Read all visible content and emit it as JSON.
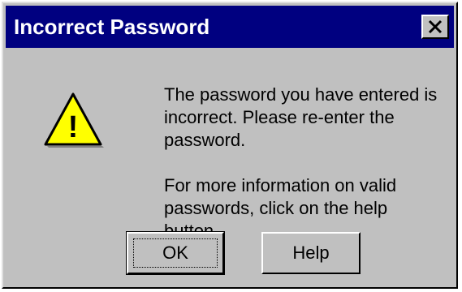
{
  "window": {
    "title": "Incorrect Password",
    "close_icon": "close-icon"
  },
  "icon": {
    "name": "warning-icon",
    "glyph": "!"
  },
  "message": {
    "line1": "The password you have entered is",
    "line2": "incorrect.  Please re-enter the",
    "line3": "password.",
    "line4": "For more information on valid",
    "line5": "passwords, click on the help button."
  },
  "buttons": {
    "ok_label": "OK",
    "help_label": "Help"
  },
  "colors": {
    "titlebar": "#000080",
    "face": "#c0c0c0",
    "warning_fill": "#ffff00"
  }
}
